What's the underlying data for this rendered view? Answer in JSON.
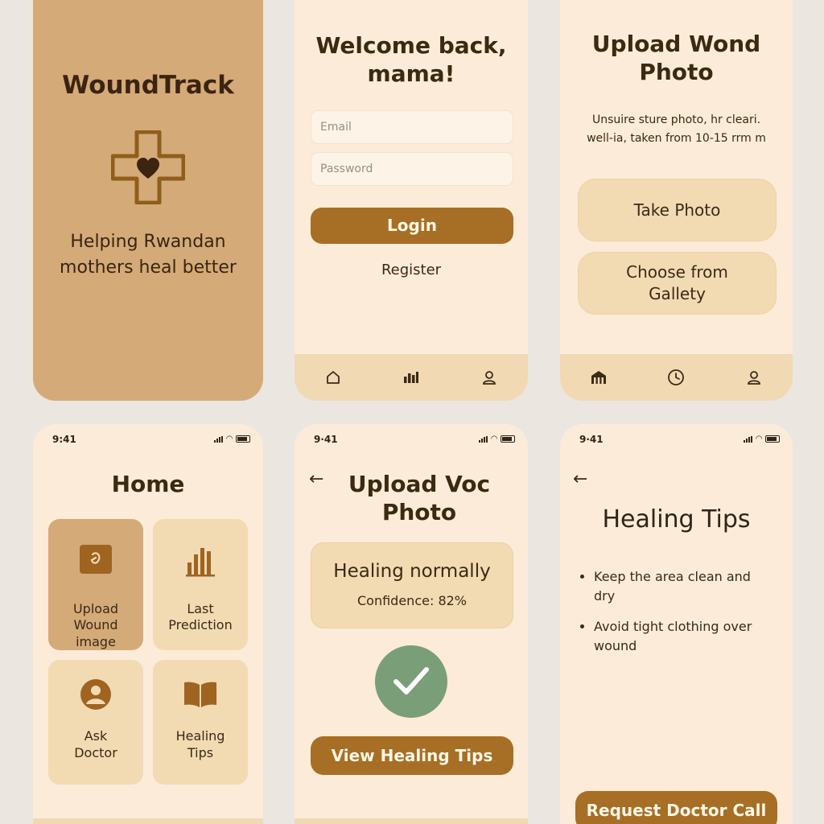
{
  "splash": {
    "app_name": "WoundTrack",
    "tagline_line1": "Helping Rwandan",
    "tagline_line2": "mothers heal better"
  },
  "login": {
    "heading_line1": "Welcome back,",
    "heading_line2": "mama!",
    "email_placeholder": "Email",
    "password_placeholder": "Password",
    "login_label": "Login",
    "register_label": "Register"
  },
  "upload": {
    "heading_line1": "Upload Wond",
    "heading_line2": "Photo",
    "instructions_line1": "Unsuire sture photo, hr cleari.",
    "instructions_line2": "well-ia, taken from 10-15 rrm m",
    "take_photo_label": "Take Photo",
    "gallery_label_line1": "Choose from",
    "gallery_label_line2": "Gallety"
  },
  "home": {
    "status_time": "9:41",
    "heading": "Home",
    "tiles": [
      {
        "line1": "Upload",
        "line2": "Wound",
        "line3": "image"
      },
      {
        "line1": "Last",
        "line2": "Prediction"
      },
      {
        "line1": "Ask",
        "line2": "Doctor"
      },
      {
        "line1": "Healing",
        "line2": "Tips"
      }
    ]
  },
  "result": {
    "status_time": "9·41",
    "heading_line1": "Upload Voc",
    "heading_line2": "Photo",
    "status_title": "Healing normally",
    "confidence": "Confidence: 82%",
    "view_tips_label": "View Healing Tips"
  },
  "tips": {
    "status_time": "9·41",
    "heading": "Healing Tips",
    "items": [
      {
        "line1": "Keep the area clean and",
        "line2": "dry"
      },
      {
        "line1": "Avoid tight clothing over",
        "line2": "wound"
      }
    ],
    "request_label": "Request Doctor Call"
  },
  "colors": {
    "accent": "#a66f25",
    "background": "#fcebd8",
    "splash_background": "#d4aa78",
    "success_circle": "#7a9e78"
  },
  "icons": {
    "nav_login": [
      "home-icon",
      "bar-chart-icon",
      "user-icon"
    ],
    "nav_upload": [
      "home-filled-icon",
      "clock-icon",
      "user-icon"
    ],
    "splash_logo": "medical-cross-heart-icon",
    "result_check": "check-icon"
  }
}
